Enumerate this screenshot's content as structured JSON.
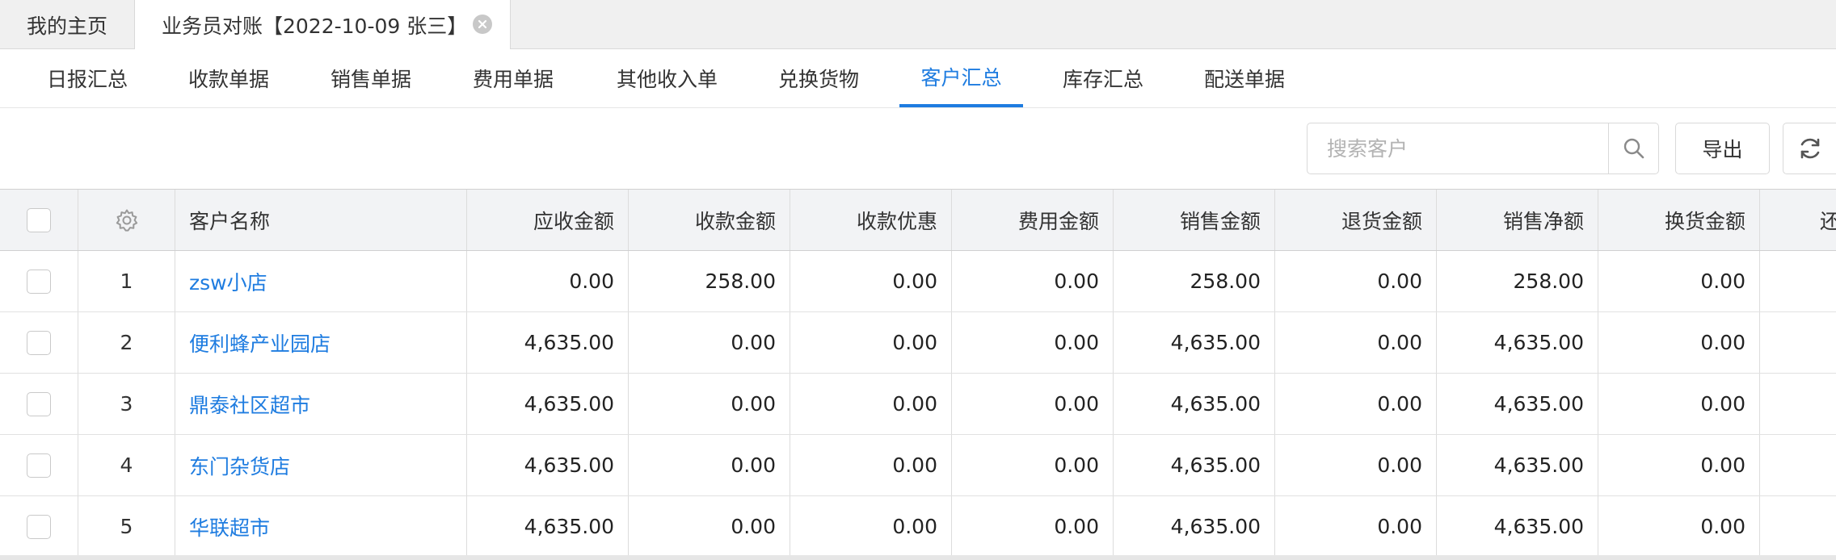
{
  "page_tabs": {
    "home_label": "我的主页",
    "active_label": "业务员对账【2022-10-09 张三】"
  },
  "sub_tabs": [
    {
      "label": "日报汇总"
    },
    {
      "label": "收款单据"
    },
    {
      "label": "销售单据"
    },
    {
      "label": "费用单据"
    },
    {
      "label": "其他收入单"
    },
    {
      "label": "兑换货物"
    },
    {
      "label": "客户汇总",
      "active": true
    },
    {
      "label": "库存汇总"
    },
    {
      "label": "配送单据"
    }
  ],
  "toolbar": {
    "search_placeholder": "搜索客户",
    "search_value": "",
    "export_label": "导出"
  },
  "table": {
    "columns": {
      "name": "客户名称",
      "receivable": "应收金额",
      "collected": "收款金额",
      "collect_discount": "收款优惠",
      "expense": "费用金额",
      "sales": "销售金额",
      "returns": "退货金额",
      "net_sales": "销售净额",
      "exchange": "换货金额",
      "partial": "还"
    },
    "rows": [
      {
        "index": "1",
        "name": "zsw小店",
        "receivable": "0.00",
        "collected": "258.00",
        "collect_discount": "0.00",
        "expense": "0.00",
        "sales": "258.00",
        "returns": "0.00",
        "net_sales": "258.00",
        "exchange": "0.00"
      },
      {
        "index": "2",
        "name": "便利蜂产业园店",
        "receivable": "4,635.00",
        "collected": "0.00",
        "collect_discount": "0.00",
        "expense": "0.00",
        "sales": "4,635.00",
        "returns": "0.00",
        "net_sales": "4,635.00",
        "exchange": "0.00"
      },
      {
        "index": "3",
        "name": "鼎泰社区超市",
        "receivable": "4,635.00",
        "collected": "0.00",
        "collect_discount": "0.00",
        "expense": "0.00",
        "sales": "4,635.00",
        "returns": "0.00",
        "net_sales": "4,635.00",
        "exchange": "0.00"
      },
      {
        "index": "4",
        "name": "东门杂货店",
        "receivable": "4,635.00",
        "collected": "0.00",
        "collect_discount": "0.00",
        "expense": "0.00",
        "sales": "4,635.00",
        "returns": "0.00",
        "net_sales": "4,635.00",
        "exchange": "0.00"
      },
      {
        "index": "5",
        "name": "华联超市",
        "receivable": "4,635.00",
        "collected": "0.00",
        "collect_discount": "0.00",
        "expense": "0.00",
        "sales": "4,635.00",
        "returns": "0.00",
        "net_sales": "4,635.00",
        "exchange": "0.00"
      }
    ]
  },
  "colors": {
    "accent": "#1e7ce0",
    "header_bg": "#f2f3f5",
    "tabbar_bg": "#f0f0f0"
  },
  "icons": {
    "close": "close-icon",
    "search": "search-icon",
    "refresh": "refresh-icon",
    "settings": "gear-icon"
  }
}
